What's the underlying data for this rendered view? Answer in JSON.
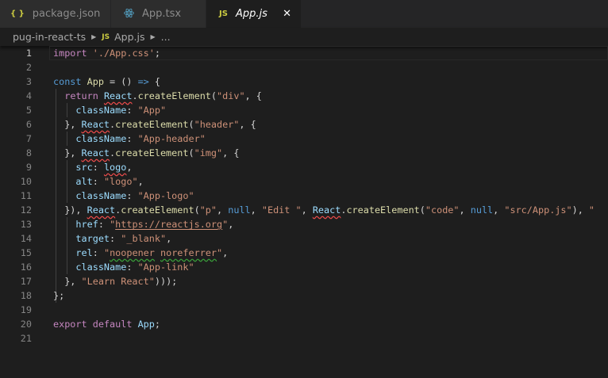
{
  "tabs": [
    {
      "label": "package.json",
      "icon": "json-braces-icon",
      "icon_text": "{ }",
      "icon_color": "#cbcb41"
    },
    {
      "label": "App.tsx",
      "icon": "react-icon",
      "icon_color": "#519aba"
    },
    {
      "label": "App.js",
      "icon": "js-icon",
      "icon_text": "JS",
      "icon_color": "#cbcb41",
      "active": true,
      "close": "✕"
    }
  ],
  "breadcrumb": {
    "folder": "pug-in-react-ts",
    "file_icon": "JS",
    "file": "App.js",
    "more": "..."
  },
  "code": [
    [
      [
        "import",
        "kw"
      ],
      [
        " ",
        ""
      ],
      [
        "'./App.css'",
        "s"
      ],
      [
        ";",
        "p"
      ]
    ],
    [],
    [
      [
        "const",
        "st"
      ],
      [
        " ",
        ""
      ],
      [
        "App",
        "f"
      ],
      [
        " = () ",
        "p"
      ],
      [
        "=>",
        "st"
      ],
      [
        " {",
        "p"
      ]
    ],
    [
      [
        "  ",
        ""
      ],
      [
        "return",
        "kw"
      ],
      [
        " ",
        ""
      ],
      [
        "React",
        "v err"
      ],
      [
        ".",
        "p"
      ],
      [
        "createElement",
        "f"
      ],
      [
        "(",
        "p"
      ],
      [
        "\"div\"",
        "s"
      ],
      [
        ", {",
        "p"
      ]
    ],
    [
      [
        "    ",
        ""
      ],
      [
        "className",
        "v"
      ],
      [
        ": ",
        "p"
      ],
      [
        "\"App\"",
        "s"
      ]
    ],
    [
      [
        "  }, ",
        "p"
      ],
      [
        "React",
        "v err"
      ],
      [
        ".",
        "p"
      ],
      [
        "createElement",
        "f"
      ],
      [
        "(",
        "p"
      ],
      [
        "\"header\"",
        "s"
      ],
      [
        ", {",
        "p"
      ]
    ],
    [
      [
        "    ",
        ""
      ],
      [
        "className",
        "v"
      ],
      [
        ": ",
        "p"
      ],
      [
        "\"App-header\"",
        "s"
      ]
    ],
    [
      [
        "  }, ",
        "p"
      ],
      [
        "React",
        "v err"
      ],
      [
        ".",
        "p"
      ],
      [
        "createElement",
        "f"
      ],
      [
        "(",
        "p"
      ],
      [
        "\"img\"",
        "s"
      ],
      [
        ", {",
        "p"
      ]
    ],
    [
      [
        "    ",
        ""
      ],
      [
        "src",
        "v"
      ],
      [
        ": ",
        "p"
      ],
      [
        "logo",
        "v err"
      ],
      [
        ",",
        "p"
      ]
    ],
    [
      [
        "    ",
        ""
      ],
      [
        "alt",
        "v"
      ],
      [
        ": ",
        "p"
      ],
      [
        "\"logo\"",
        "s"
      ],
      [
        ",",
        "p"
      ]
    ],
    [
      [
        "    ",
        ""
      ],
      [
        "className",
        "v"
      ],
      [
        ": ",
        "p"
      ],
      [
        "\"App-logo\"",
        "s"
      ]
    ],
    [
      [
        "  }), ",
        "p"
      ],
      [
        "React",
        "v err"
      ],
      [
        ".",
        "p"
      ],
      [
        "createElement",
        "f"
      ],
      [
        "(",
        "p"
      ],
      [
        "\"p\"",
        "s"
      ],
      [
        ", ",
        "p"
      ],
      [
        "null",
        "st"
      ],
      [
        ", ",
        "p"
      ],
      [
        "\"Edit \"",
        "s"
      ],
      [
        ", ",
        "p"
      ],
      [
        "React",
        "v err"
      ],
      [
        ".",
        "p"
      ],
      [
        "createElement",
        "f"
      ],
      [
        "(",
        "p"
      ],
      [
        "\"code\"",
        "s"
      ],
      [
        ", ",
        "p"
      ],
      [
        "null",
        "st"
      ],
      [
        ", ",
        "p"
      ],
      [
        "\"src/App.js\"",
        "s"
      ],
      [
        "), ",
        "p"
      ],
      [
        "\"",
        "s"
      ]
    ],
    [
      [
        "    ",
        ""
      ],
      [
        "href",
        "v"
      ],
      [
        ": ",
        "p"
      ],
      [
        "\"",
        "s"
      ],
      [
        "https://reactjs.org",
        "s link"
      ],
      [
        "\"",
        "s"
      ],
      [
        ",",
        "p"
      ]
    ],
    [
      [
        "    ",
        ""
      ],
      [
        "target",
        "v"
      ],
      [
        ": ",
        "p"
      ],
      [
        "\"_blank\"",
        "s"
      ],
      [
        ",",
        "p"
      ]
    ],
    [
      [
        "    ",
        ""
      ],
      [
        "rel",
        "v"
      ],
      [
        ": ",
        "p"
      ],
      [
        "\"",
        "s"
      ],
      [
        "noopener",
        "s warn"
      ],
      [
        " ",
        "s"
      ],
      [
        "noreferrer",
        "s warn"
      ],
      [
        "\"",
        "s"
      ],
      [
        ",",
        "p"
      ]
    ],
    [
      [
        "    ",
        ""
      ],
      [
        "className",
        "v"
      ],
      [
        ": ",
        "p"
      ],
      [
        "\"App-link\"",
        "s"
      ]
    ],
    [
      [
        "  }, ",
        "p"
      ],
      [
        "\"Learn React\"",
        "s"
      ],
      [
        ")));",
        "p"
      ]
    ],
    [
      [
        "};",
        "p"
      ]
    ],
    [],
    [
      [
        "export",
        "kw"
      ],
      [
        " ",
        ""
      ],
      [
        "default",
        "kw"
      ],
      [
        " ",
        ""
      ],
      [
        "App",
        "v"
      ],
      [
        ";",
        "p"
      ]
    ],
    []
  ]
}
